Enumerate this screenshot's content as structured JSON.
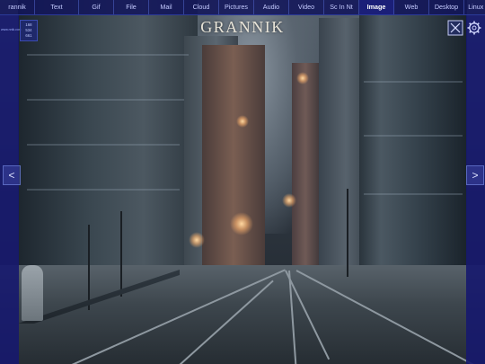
{
  "nav": {
    "tabs": [
      {
        "label": "rannik",
        "active": false
      },
      {
        "label": "Text",
        "active": false
      },
      {
        "label": "Gif",
        "active": false
      },
      {
        "label": "File",
        "active": false
      },
      {
        "label": "Mail",
        "active": false
      },
      {
        "label": "Cloud",
        "active": false
      },
      {
        "label": "Pictures",
        "active": false
      },
      {
        "label": "Audio",
        "active": false
      },
      {
        "label": "Video",
        "active": false
      },
      {
        "label": "Sc In Nt",
        "active": false
      },
      {
        "label": "Image",
        "active": true
      },
      {
        "label": "Web",
        "active": false
      },
      {
        "label": "Desktop",
        "active": false
      },
      {
        "label": "Linux OS",
        "active": false
      }
    ]
  },
  "brand": {
    "title": "GRANNIK"
  },
  "sidebar": {
    "tiny_label": "www.nnik.com"
  },
  "stats": {
    "line1": "168",
    "line2": "534",
    "line3": "661"
  },
  "controls": {
    "close_icon": "close-box-icon",
    "settings_icon": "gear-icon",
    "prev_icon": "chevron-left-icon",
    "next_icon": "chevron-right-icon",
    "prev_glyph": "<",
    "next_glyph": ">"
  },
  "colors": {
    "chrome": "#16186e",
    "active_tab": "#1b1f78",
    "tab_text": "#c5cbff"
  }
}
